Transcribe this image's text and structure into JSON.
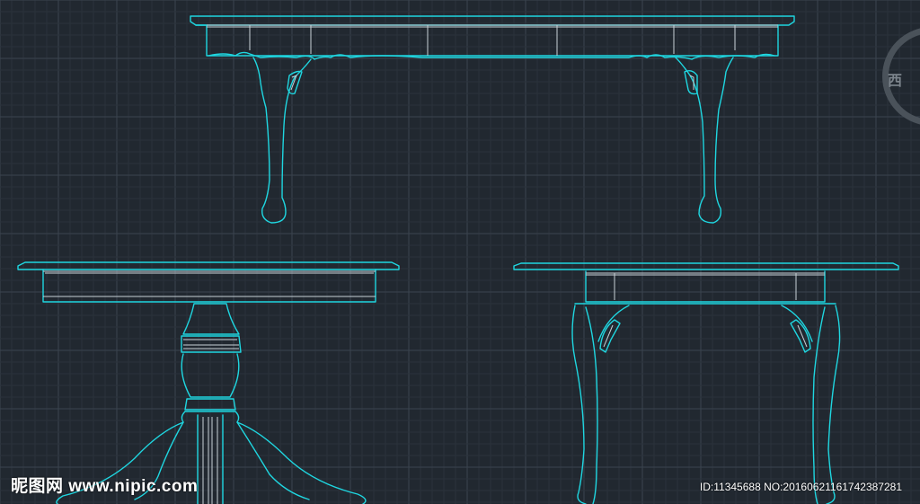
{
  "colors": {
    "background": "#212830",
    "drawing_line": "#1fd6e0",
    "detail_line": "#c9d2d8",
    "grid": "#3a444f"
  },
  "viewcube": {
    "label": "西"
  },
  "watermark": {
    "text": "昵图网 www.nipic.com"
  },
  "image_id": {
    "text": "ID:11345688 NO:20160621161742387281"
  }
}
